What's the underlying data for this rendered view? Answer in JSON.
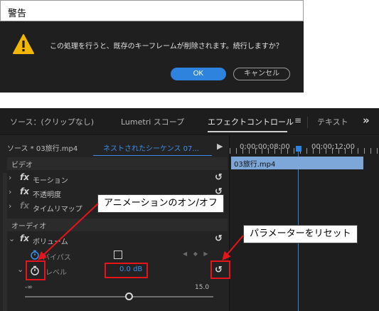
{
  "dialog": {
    "title": "警告",
    "message": "この処理を行うと、既存のキーフレームが削除されます。続行しますか？",
    "ok_label": "OK",
    "cancel_label": "キャンセル",
    "icon": "warning-icon",
    "accent_color": "#2d83de"
  },
  "panel": {
    "tabs": [
      {
        "label": "ソース：(クリップなし)"
      },
      {
        "label": "Lumetri スコープ"
      },
      {
        "label": "エフェクトコントロール",
        "active": true
      },
      {
        "label": "テキスト"
      }
    ],
    "menu_icon": "≡",
    "overflow_icon": "»",
    "source_label": "ソース * 03旅行.mp4",
    "sequence_label": "ネストされたシーケンス 07...",
    "timeline": {
      "timecode_start": "0;00;00;08;00",
      "timecode_end": "00;00;12;00",
      "clip_name": "03旅行.mp4"
    },
    "sections": {
      "video": "ビデオ",
      "audio": "オーディオ"
    },
    "effects": {
      "motion": "モーション",
      "opacity": "不透明度",
      "time_remap": "タイムリマップ",
      "volume": "ボリューム",
      "bypass": "バイパス",
      "level": "レベル"
    },
    "level_value": "0.0 dB",
    "level_slider": {
      "min_label": "-∞",
      "max_label": "15.0"
    }
  },
  "annotations": {
    "animation_toggle": "アニメーションのオン/オフ",
    "reset_parameter": "パラメーターをリセット",
    "highlight_color": "#e8141c"
  }
}
